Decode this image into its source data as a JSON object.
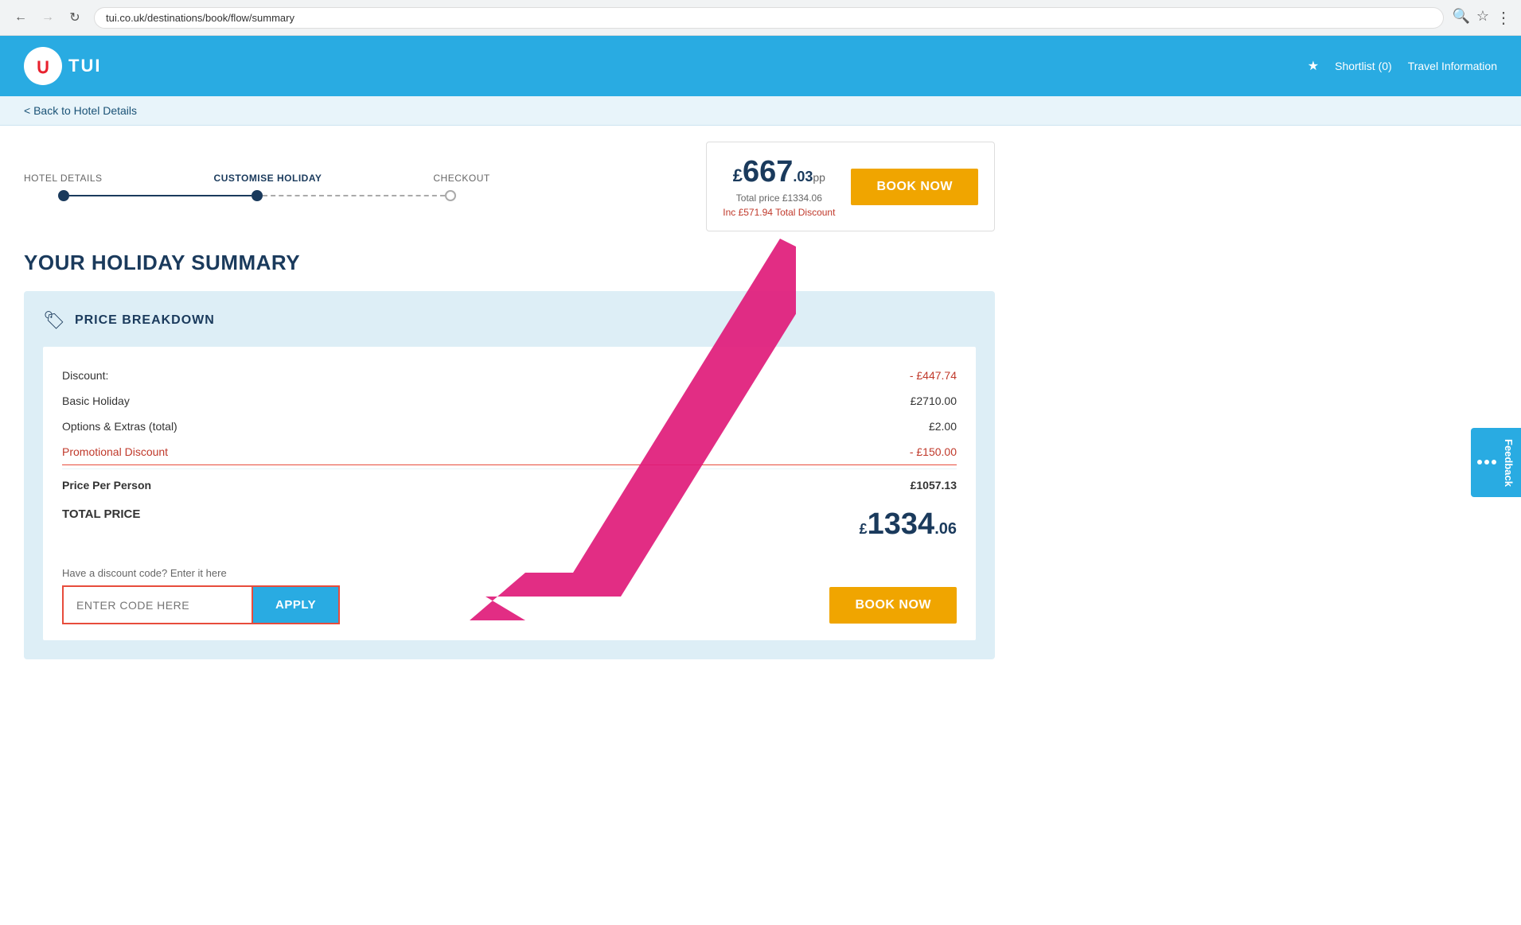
{
  "browser": {
    "url": "tui.co.uk/destinations/book/flow/summary"
  },
  "header": {
    "logo_text": "TUI",
    "shortlist_label": "Shortlist (0)",
    "travel_info_label": "Travel Information"
  },
  "subheader": {
    "back_label": "< Back to Hotel Details"
  },
  "progress": {
    "steps": [
      {
        "label": "HOTEL DETAILS",
        "state": "done"
      },
      {
        "label": "CUSTOMISE HOLIDAY",
        "state": "active"
      },
      {
        "label": "CHECKOUT",
        "state": "pending"
      }
    ]
  },
  "booking_box": {
    "currency_symbol": "£",
    "price_main": "667",
    "price_decimal": ".03",
    "price_unit": "pp",
    "total_label": "Total price £1334.06",
    "discount_label": "Inc £571.94 Total Discount",
    "book_now_label": "BOOK NOW"
  },
  "summary": {
    "title": "YOUR HOLIDAY SUMMARY",
    "price_breakdown": {
      "section_title": "PRICE BREAKDOWN",
      "rows": [
        {
          "label": "Discount:",
          "value": "- £447.74",
          "is_red": true,
          "is_bold": false
        },
        {
          "label": "Basic Holiday",
          "value": "£2710.00",
          "is_red": false,
          "is_bold": false
        },
        {
          "label": "Options & Extras (total)",
          "value": "£2.00",
          "is_red": false,
          "is_bold": false
        },
        {
          "label": "Promotional Discount",
          "value": "- £150.00",
          "is_red": true,
          "is_bold": false,
          "has_bottom_border": true
        }
      ],
      "price_per_person_label": "Price Per Person",
      "price_per_person_value": "£1057.13",
      "total_label": "TOTAL PRICE",
      "total_currency": "£",
      "total_main": "1334",
      "total_decimal": ".06"
    },
    "discount_code": {
      "label": "Have a discount code? Enter it here",
      "input_placeholder": "ENTER CODE HERE",
      "apply_label": "APPLY",
      "book_now_label": "BOOK NOW"
    }
  },
  "feedback": {
    "label": "Feedback"
  }
}
